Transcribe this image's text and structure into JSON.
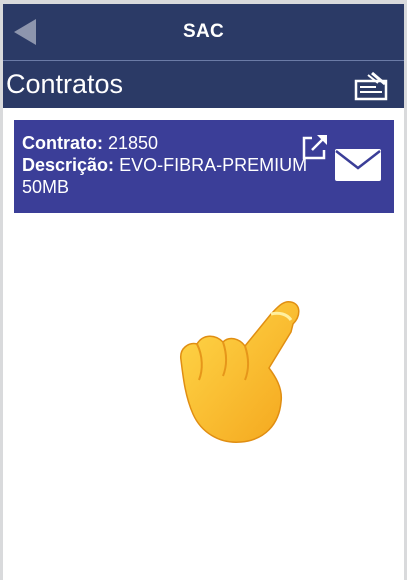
{
  "header": {
    "title": "SAC",
    "back_icon": "back-arrow-icon"
  },
  "subheader": {
    "title": "Contratos",
    "action_icon": "notes-icon"
  },
  "contract": {
    "contract_label": "Contrato:",
    "contract_value": "21850",
    "description_label": "Descrição:",
    "description_value": "EVO-FIBRA-PREMIUM",
    "description_extra": "50MB",
    "open_icon": "external-link-icon",
    "mail_icon": "mail-icon"
  },
  "overlay": {
    "icon": "pointing-hand-icon"
  },
  "colors": {
    "header_bg": "#2b3a66",
    "card_bg": "#3b3e98",
    "text_light": "#ffffff"
  }
}
